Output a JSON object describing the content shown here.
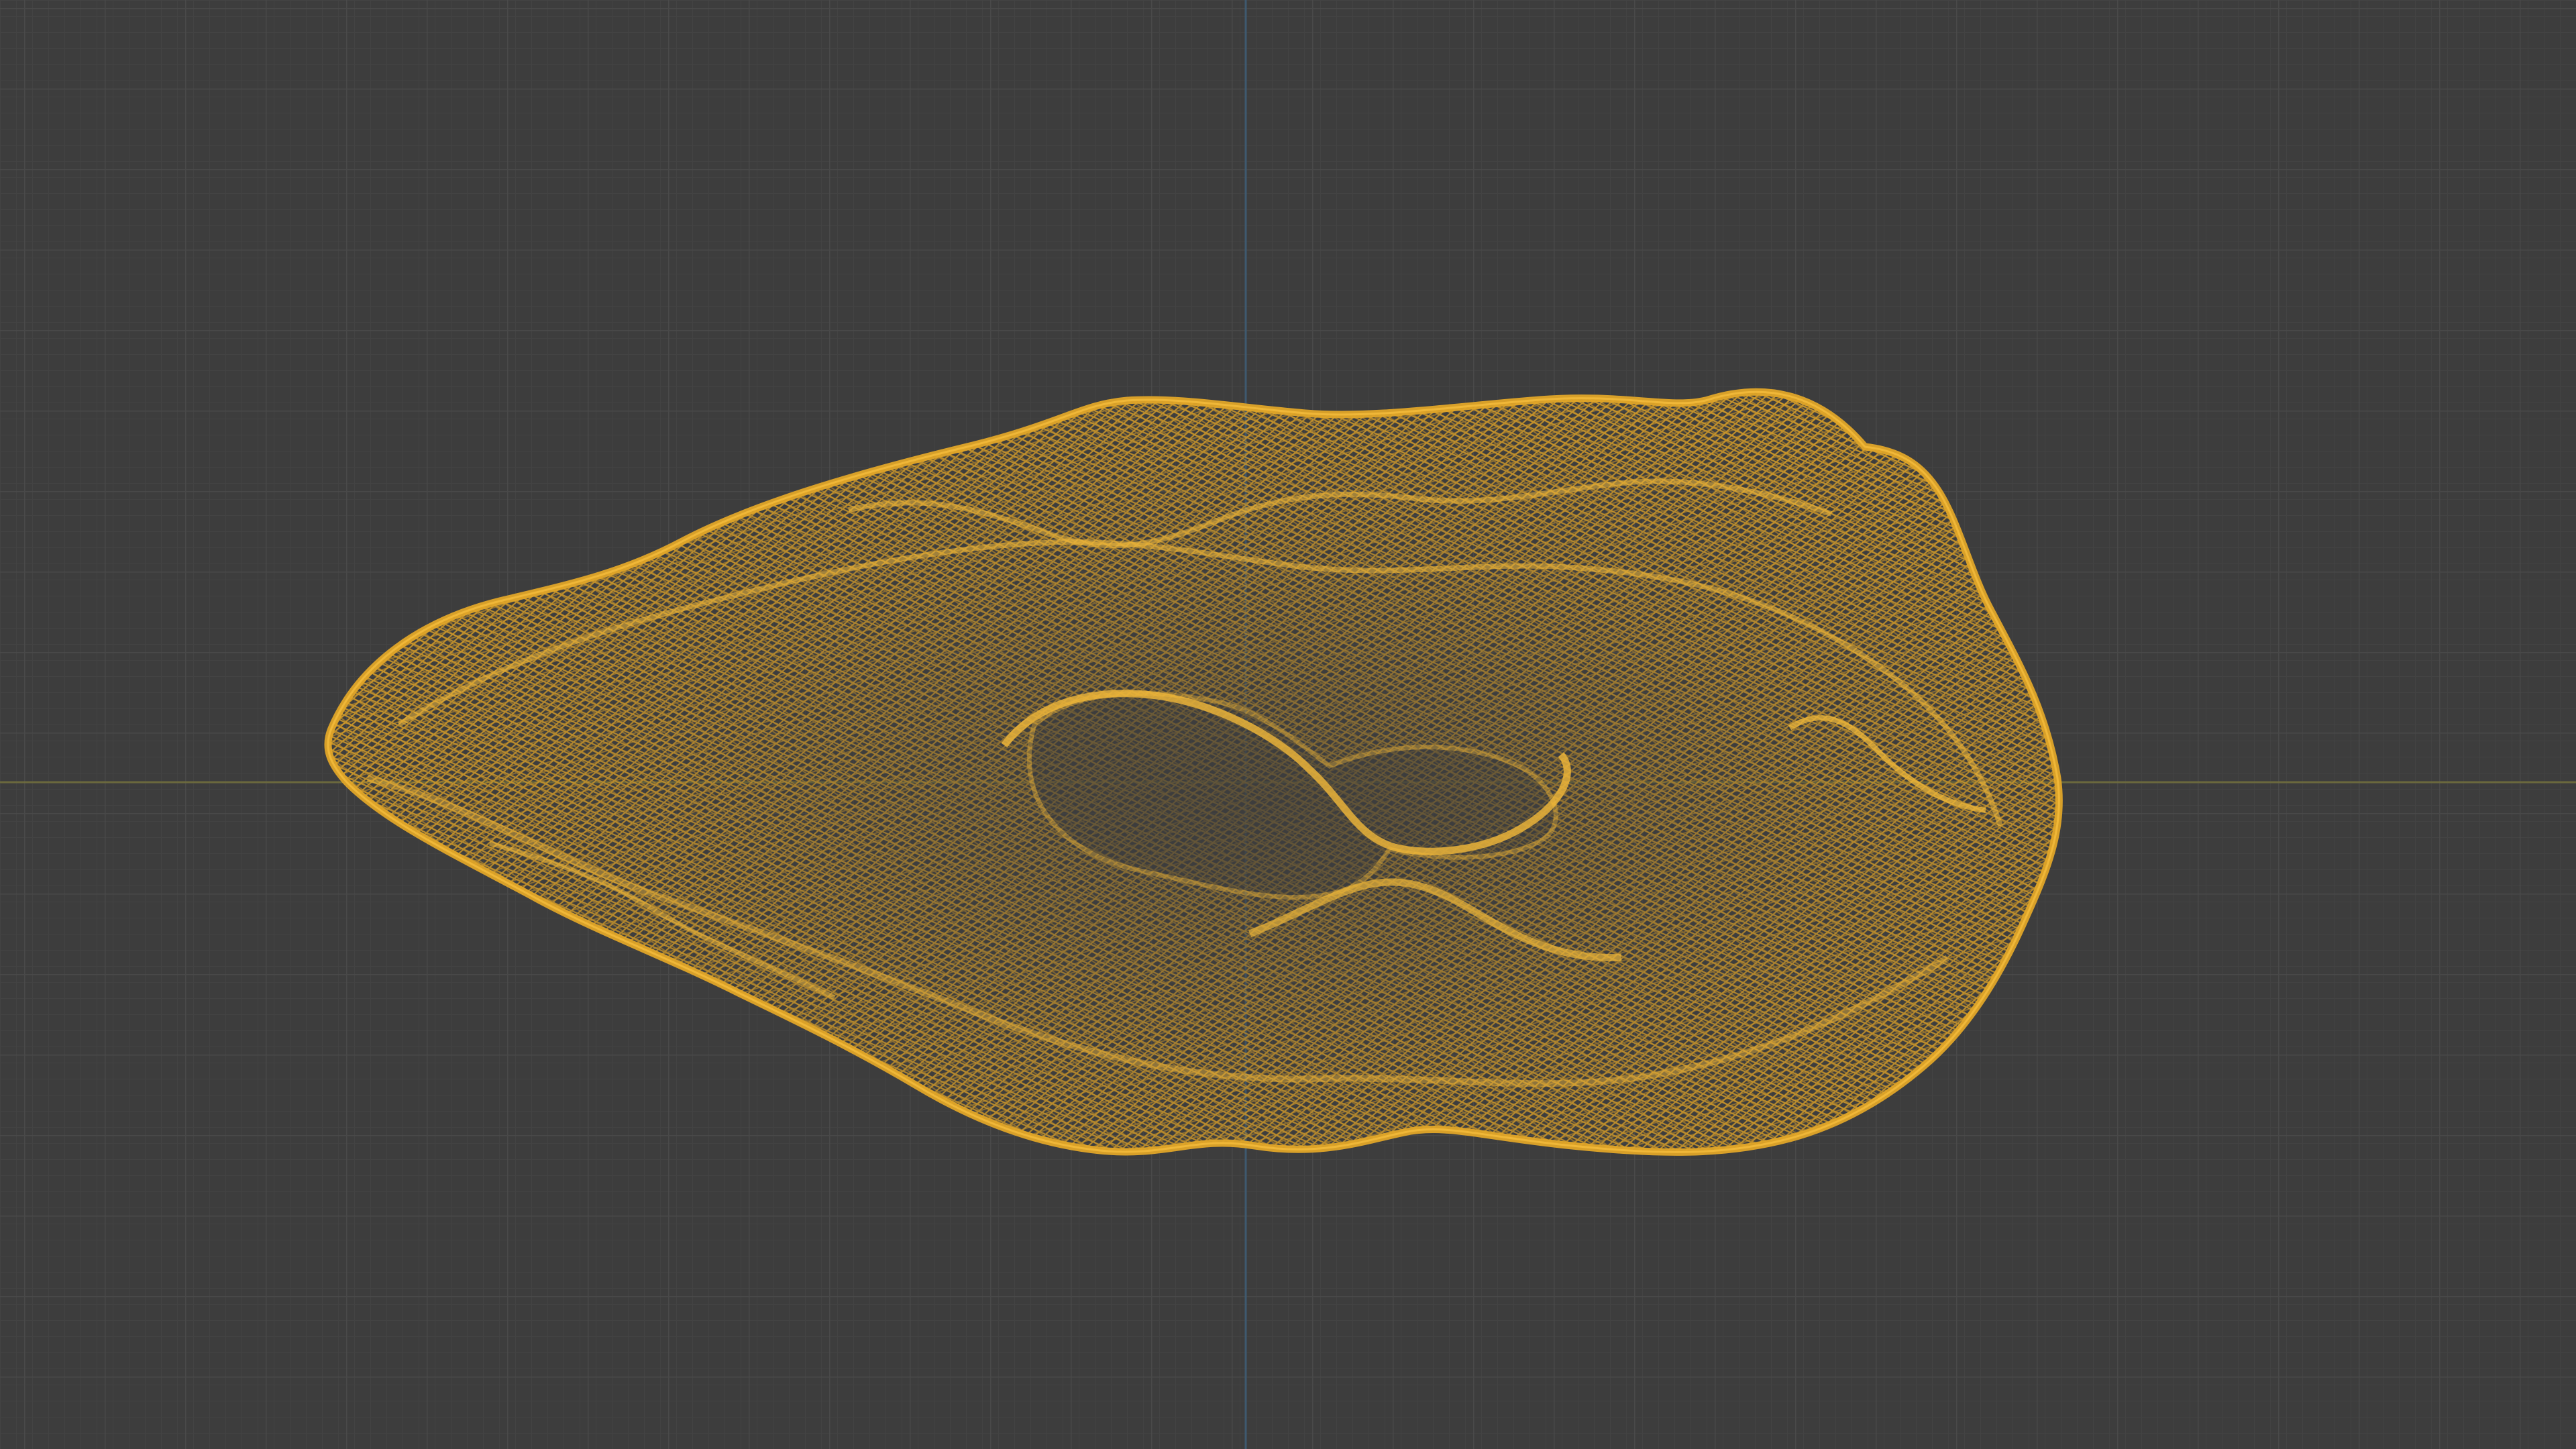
{
  "viewport": {
    "background_color": "#3d3d3d",
    "minor_grid_color": "#444444",
    "major_grid_color": "#4b4b4b",
    "x_axis_color": "#6f6d3e",
    "y_axis_color": "#3f5b72",
    "wire_color": "#e0a528",
    "wire_highlight_color": "#f2b93a"
  },
  "object": {
    "icon": "wireframe-mesh-icon",
    "display_mode": "wireframe",
    "selected": true
  }
}
